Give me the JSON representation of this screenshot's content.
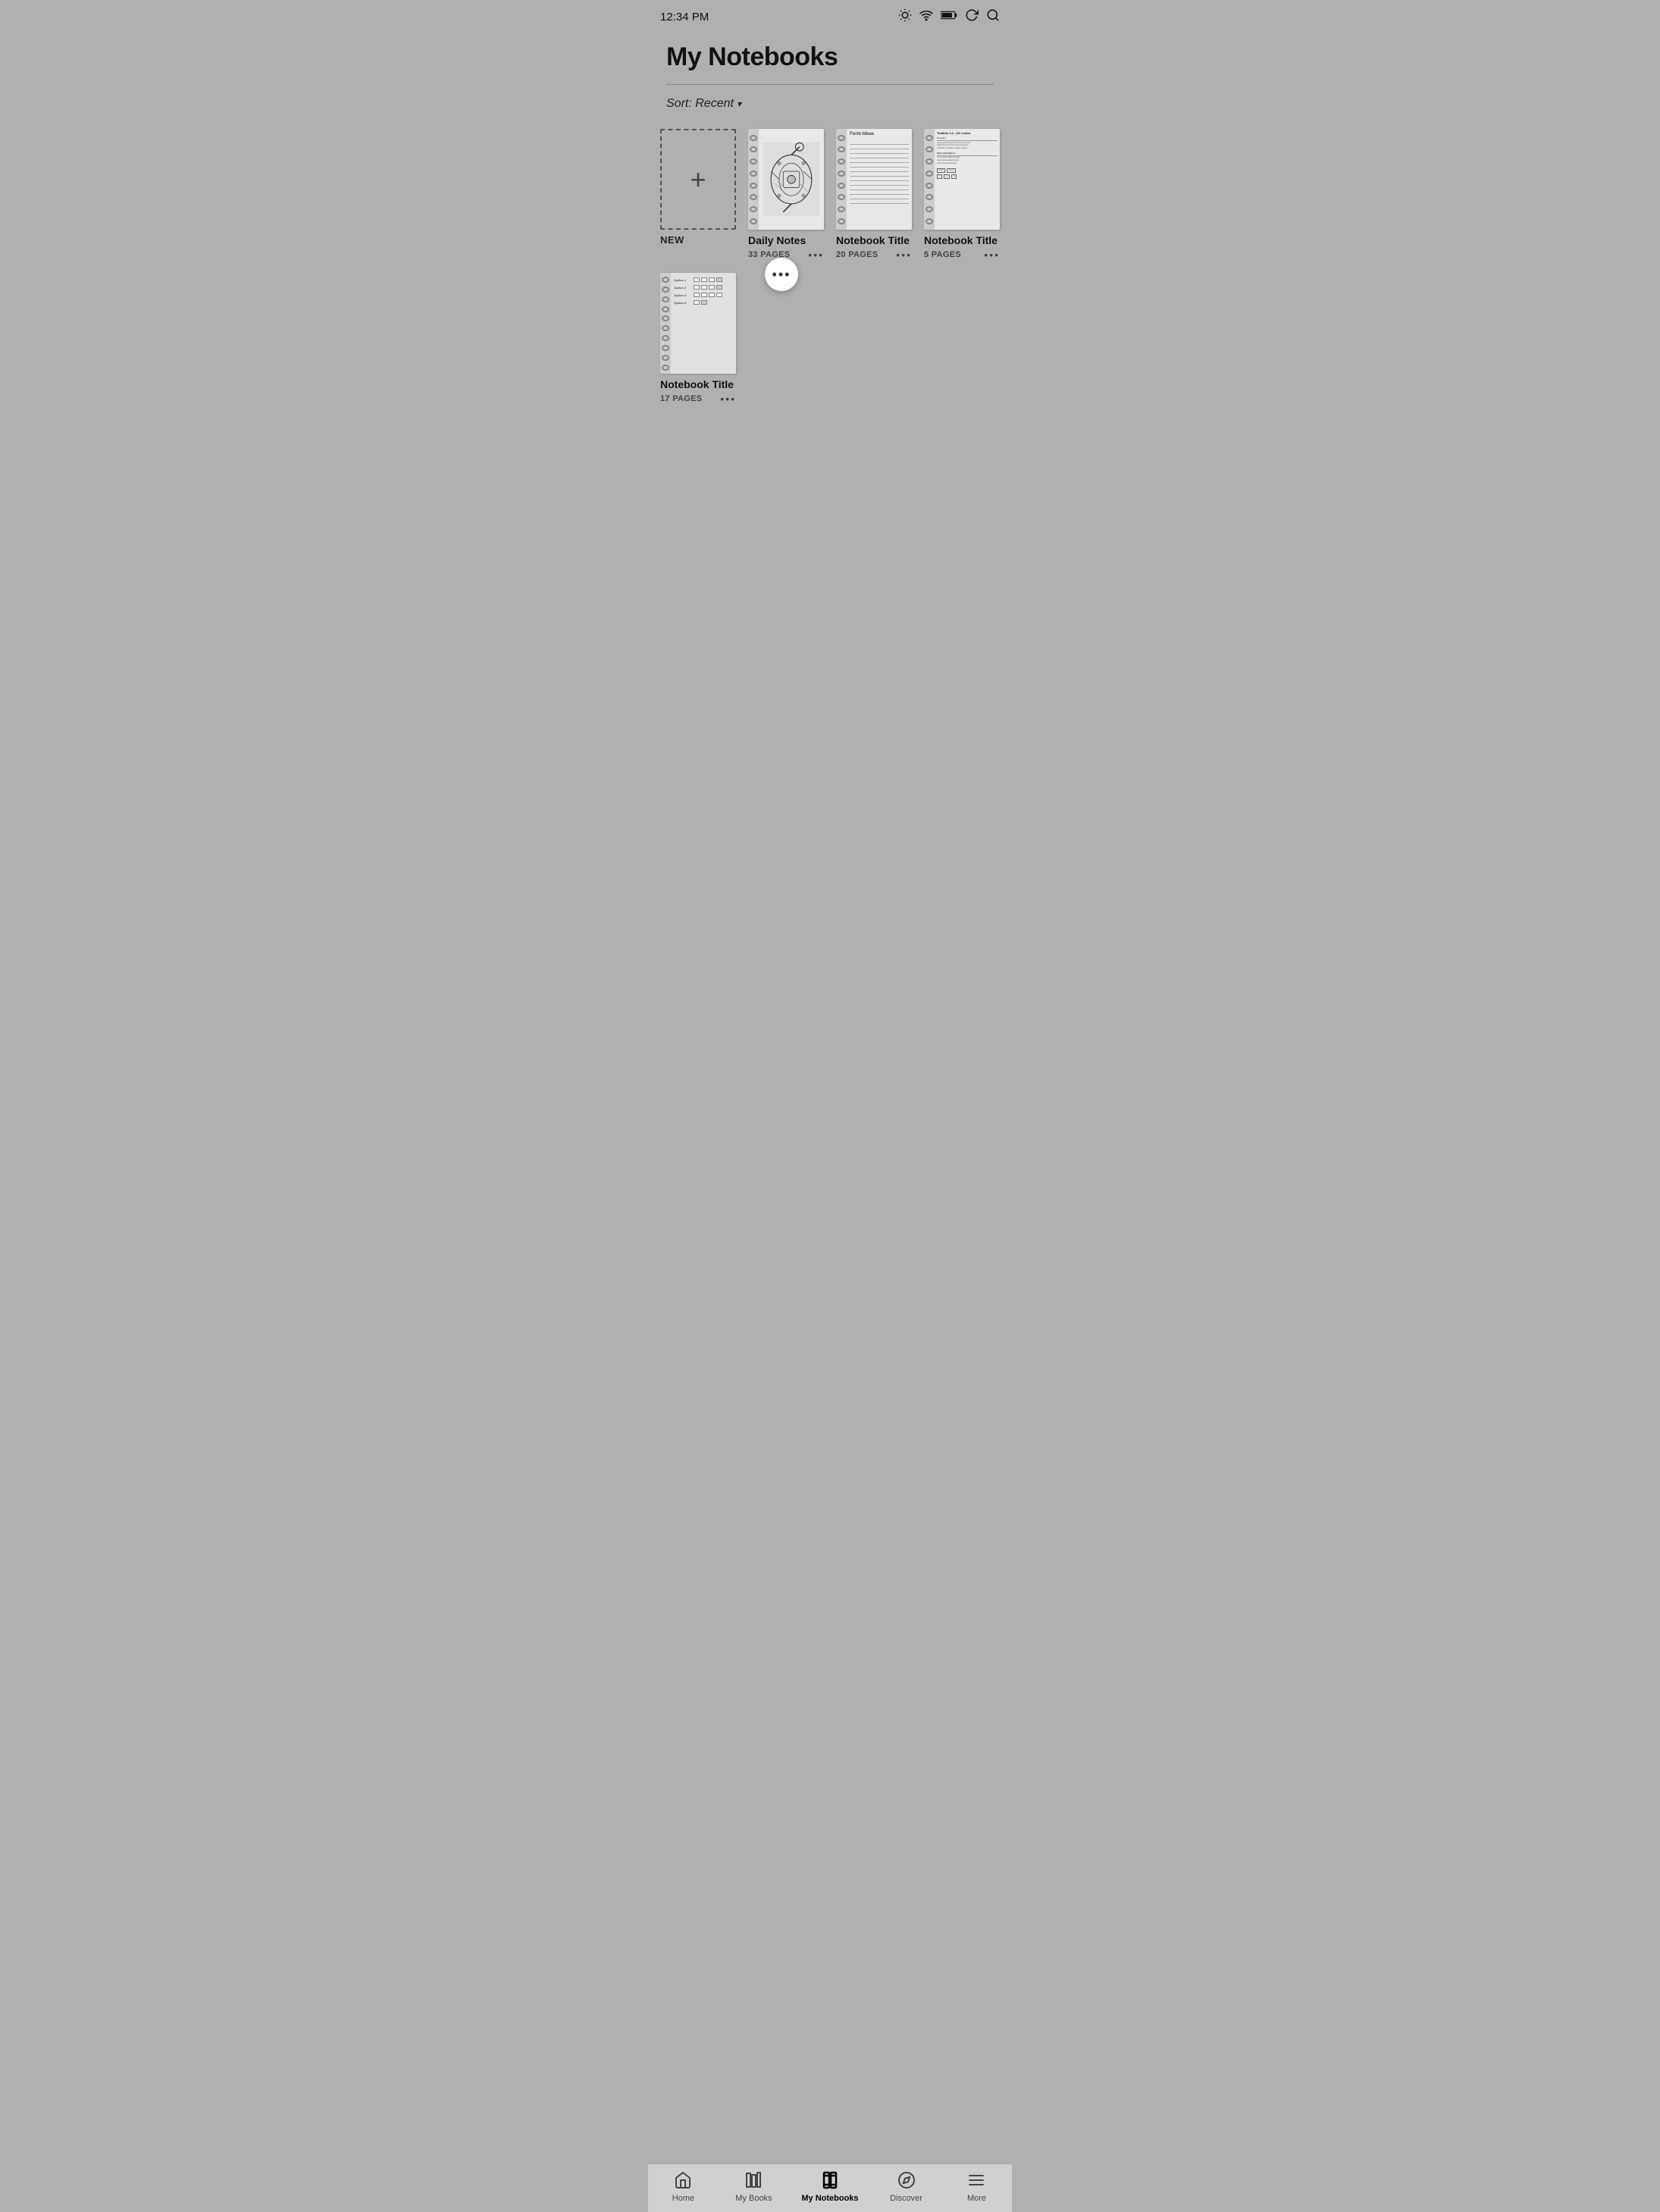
{
  "statusBar": {
    "time": "12:34 PM"
  },
  "header": {
    "title": "My Notebooks",
    "sortLabel": "Sort: Recent"
  },
  "notebooks": [
    {
      "id": "new",
      "type": "new",
      "label": "NEW"
    },
    {
      "id": "daily-notes",
      "type": "notebook",
      "title": "Daily Notes",
      "pages": "33 PAGES",
      "coverType": "sketch-mechanical",
      "hasFloatingMenu": true
    },
    {
      "id": "notebook-2",
      "type": "notebook",
      "title": "Notebook Title",
      "pages": "20 PAGES",
      "coverType": "lined-blank",
      "topText": "Form Ideas"
    },
    {
      "id": "notebook-3",
      "type": "notebook",
      "title": "Notebook Title",
      "pages": "5 PAGES",
      "coverType": "text-content",
      "topText": "Toolkits 1.6 - UX review"
    },
    {
      "id": "notebook-4",
      "type": "notebook",
      "title": "Notebook Title",
      "pages": "17 PAGES",
      "coverType": "checkbox-grid"
    }
  ],
  "floatingMore": {
    "dots": "•••"
  },
  "bottomNav": {
    "items": [
      {
        "id": "home",
        "label": "Home",
        "icon": "home",
        "active": false
      },
      {
        "id": "my-books",
        "label": "My Books",
        "icon": "books",
        "active": false
      },
      {
        "id": "my-notebooks",
        "label": "My Notebooks",
        "icon": "notebooks",
        "active": true
      },
      {
        "id": "discover",
        "label": "Discover",
        "icon": "compass",
        "active": false
      },
      {
        "id": "more",
        "label": "More",
        "icon": "menu",
        "active": false
      }
    ]
  }
}
